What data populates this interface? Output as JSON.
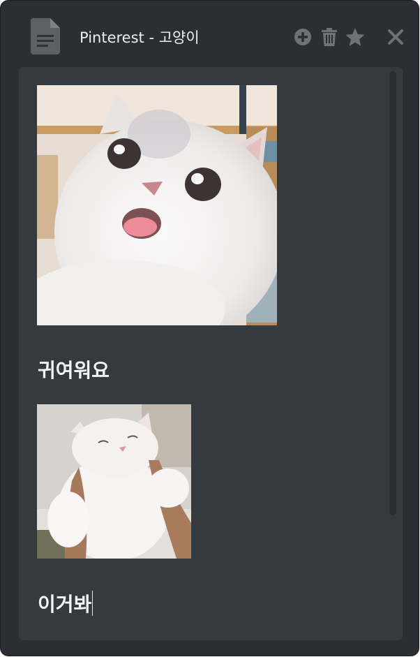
{
  "window": {
    "title": "Pinterest - 고양이"
  },
  "toolbar": {
    "icons": [
      "document-icon",
      "add-icon",
      "trash-icon",
      "star-icon",
      "close-icon"
    ]
  },
  "note": {
    "blocks": [
      {
        "type": "image",
        "description_name": "cat-photo-1"
      },
      {
        "type": "text",
        "text": "귀여워요"
      },
      {
        "type": "image",
        "description_name": "cat-photo-2"
      },
      {
        "type": "text",
        "text": "이거봐"
      }
    ],
    "caption_1": "귀여워요",
    "caption_2": "이거봐"
  },
  "colors": {
    "window_bg": "#2b2f33",
    "content_bg": "#353a3e",
    "icon_gray": "#6c7277",
    "text": "#f2f4f5"
  }
}
